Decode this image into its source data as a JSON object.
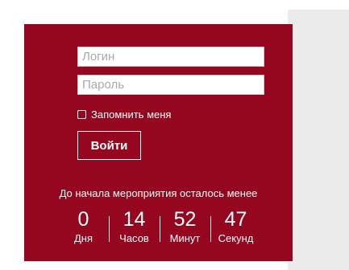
{
  "login_form": {
    "login_placeholder": "Логин",
    "password_placeholder": "Пароль",
    "remember_label": "Запомнить меня",
    "remember_checked": false,
    "submit_label": "Войти"
  },
  "countdown": {
    "title": "До начала мероприятия осталось менее",
    "days": {
      "value": "0",
      "label": "Дня"
    },
    "hours": {
      "value": "14",
      "label": "Часов"
    },
    "minutes": {
      "value": "52",
      "label": "Минут"
    },
    "seconds": {
      "value": "47",
      "label": "Секунд"
    }
  },
  "colors": {
    "panel_background": "#94071e",
    "side_strip": "#ebebeb",
    "text": "#ffffff"
  }
}
